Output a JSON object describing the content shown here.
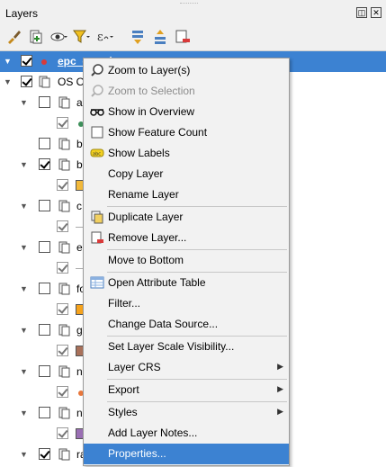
{
  "panel": {
    "title": "Layers",
    "float_btn": "◫",
    "close_btn": "✕"
  },
  "toolbar": {
    "icons": [
      "style-brush-icon",
      "add-group-icon",
      "visibility-eye-icon",
      "filter-icon",
      "expression-filter-icon",
      "expand-all-icon",
      "collapse-all-icon",
      "remove-layer-icon"
    ]
  },
  "tree": {
    "rows": [
      {
        "label": "epc_coords",
        "selected": true
      },
      {
        "label": "OS O"
      },
      {
        "label": "a"
      },
      {
        "label": "b"
      },
      {
        "label": "b"
      },
      {
        "label": "c"
      },
      {
        "label": "e"
      },
      {
        "label": "fo"
      },
      {
        "label": "g"
      },
      {
        "label": "n"
      },
      {
        "label": "n"
      },
      {
        "label": "ra"
      },
      {
        "label": "ra"
      },
      {
        "label": "ro"
      },
      {
        "label": "se"
      }
    ],
    "colors": {
      "selection": "#3c82d2",
      "yellow": "#f2b93b",
      "orange": "#f6a31c",
      "brown": "#a9715a",
      "purple": "#9a6fb4",
      "green": "#3d8f5a",
      "red": "#d93a3a"
    }
  },
  "context_menu": {
    "items": [
      {
        "label": "Zoom to Layer(s)",
        "icon": "zoom-layer-icon",
        "enabled": true
      },
      {
        "label": "Zoom to Selection",
        "icon": "zoom-selection-icon",
        "enabled": false
      },
      {
        "label": "Show in Overview",
        "icon": "overview-glasses-icon",
        "enabled": true
      },
      {
        "label": "Show Feature Count",
        "icon": "checkbox-icon",
        "enabled": true
      },
      {
        "label": "Show Labels",
        "icon": "labels-abc-icon",
        "enabled": true
      },
      {
        "label": "Copy Layer",
        "enabled": true
      },
      {
        "label": "Rename Layer",
        "enabled": true
      },
      {
        "label": "Duplicate Layer",
        "icon": "duplicate-layer-icon",
        "enabled": true
      },
      {
        "label": "Remove Layer...",
        "icon": "remove-layer-icon",
        "enabled": true
      },
      {
        "label": "Move to Bottom",
        "enabled": true
      },
      {
        "label": "Open Attribute Table",
        "icon": "attribute-table-icon",
        "enabled": true
      },
      {
        "label": "Filter...",
        "enabled": true
      },
      {
        "label": "Change Data Source...",
        "enabled": true
      },
      {
        "label": "Set Layer Scale Visibility...",
        "enabled": true
      },
      {
        "label": "Layer CRS",
        "enabled": true,
        "submenu": true
      },
      {
        "label": "Export",
        "enabled": true,
        "submenu": true
      },
      {
        "label": "Styles",
        "enabled": true,
        "submenu": true
      },
      {
        "label": "Add Layer Notes...",
        "enabled": true
      },
      {
        "label": "Properties...",
        "enabled": true,
        "highlighted": true
      }
    ]
  }
}
